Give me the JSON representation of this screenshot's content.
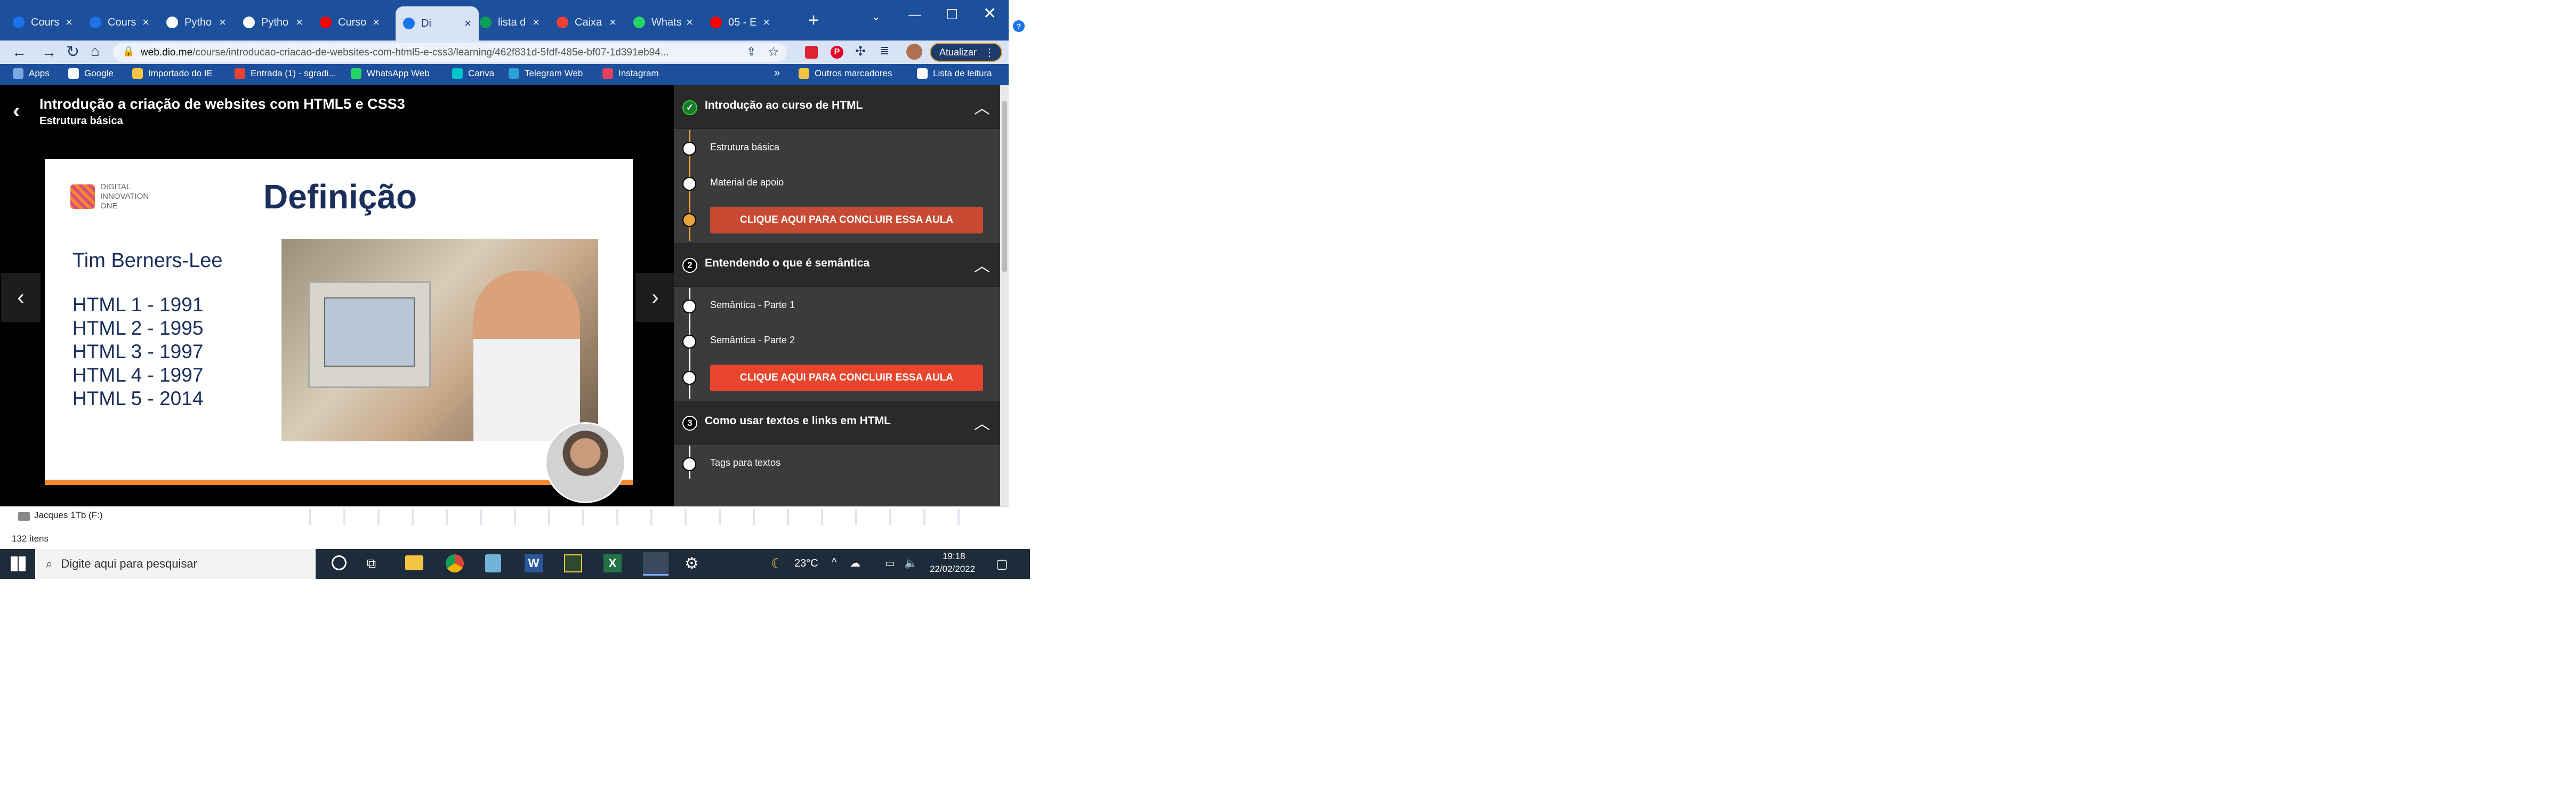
{
  "browser": {
    "tabs": [
      {
        "label": "Cours",
        "favicon": "coursera-icon",
        "color": "#1a73e8"
      },
      {
        "label": "Cours",
        "favicon": "coursera-icon",
        "color": "#1a73e8"
      },
      {
        "label": "Pytho",
        "favicon": "python-icon",
        "color": "#ffffff"
      },
      {
        "label": "Pytho",
        "favicon": "s-icon",
        "color": "#ffffff"
      },
      {
        "label": "Curso",
        "favicon": "youtube-icon",
        "color": "#ff0000"
      },
      {
        "label": "Di",
        "favicon": "dio-icon",
        "color": "#1a73e8",
        "active": true
      },
      {
        "label": "lista d",
        "favicon": "sheets-icon",
        "color": "#0f9d58"
      },
      {
        "label": "Caixa",
        "favicon": "gmail-icon",
        "color": "#ea4335"
      },
      {
        "label": "Whats",
        "favicon": "whatsapp-icon",
        "color": "#25d366"
      },
      {
        "label": "05 - E",
        "favicon": "youtube-icon",
        "color": "#ff0000"
      }
    ],
    "address_host": "web.dio.me",
    "address_path": "/course/introducao-criacao-de-websites-com-html5-e-css3/learning/462f831d-5fdf-485e-bf07-1d391eb94...",
    "update_button": "Atualizar",
    "bookmarks": [
      {
        "label": "Apps",
        "icon": "apps-grid-icon"
      },
      {
        "label": "Google",
        "icon": "google-icon"
      },
      {
        "label": "Importado do IE",
        "icon": "folder-icon"
      },
      {
        "label": "Entrada (1) - sgradi...",
        "icon": "gmail-icon"
      },
      {
        "label": "WhatsApp Web",
        "icon": "whatsapp-icon"
      },
      {
        "label": "Canva",
        "icon": "canva-icon"
      },
      {
        "label": "Telegram Web",
        "icon": "telegram-icon"
      },
      {
        "label": "Instagram",
        "icon": "instagram-icon"
      }
    ],
    "bookmarks_more": "»",
    "other_bookmarks": "Outros marcadores",
    "reading_list": "Lista de leitura"
  },
  "course": {
    "title": "Introdução a criação de websites com HTML5 e CSS3",
    "subtitle": "Estrutura básica",
    "slide": {
      "logo_line1": "DIGITAL",
      "logo_line2": "INNOVATION",
      "logo_line3": "ONE",
      "heading": "Definição",
      "person": "Tim Berners-Lee",
      "versions": [
        "HTML 1 - 1991",
        "HTML 2 - 1995",
        "HTML 3 - 1997",
        "HTML 4 - 1997",
        "HTML 5 - 2014"
      ]
    }
  },
  "sidebar": {
    "sections": [
      {
        "title": "Introdução ao curso de HTML",
        "items": [
          "Estrutura básica",
          "Material de apoio"
        ],
        "cta": "CLIQUE AQUI PARA CONCLUIR ESSA AULA",
        "cta_color": "#c94a33"
      },
      {
        "number": "2",
        "title": "Entendendo o que é semântica",
        "items": [
          "Semântica - Parte 1",
          "Semântica - Parte 2"
        ],
        "cta": "CLIQUE AQUI PARA CONCLUIR ESSA AULA",
        "cta_color": "#e8452c"
      },
      {
        "number": "3",
        "title": "Como usar textos e links em HTML",
        "items": [
          "Tags para textos"
        ]
      }
    ]
  },
  "explorer": {
    "drive": "Jacques 1Tb (F:)",
    "item_count": "132 itens"
  },
  "taskbar": {
    "search_placeholder": "Digite aqui para pesquisar",
    "temperature": "23°C",
    "time": "19:18",
    "date": "22/02/2022"
  }
}
